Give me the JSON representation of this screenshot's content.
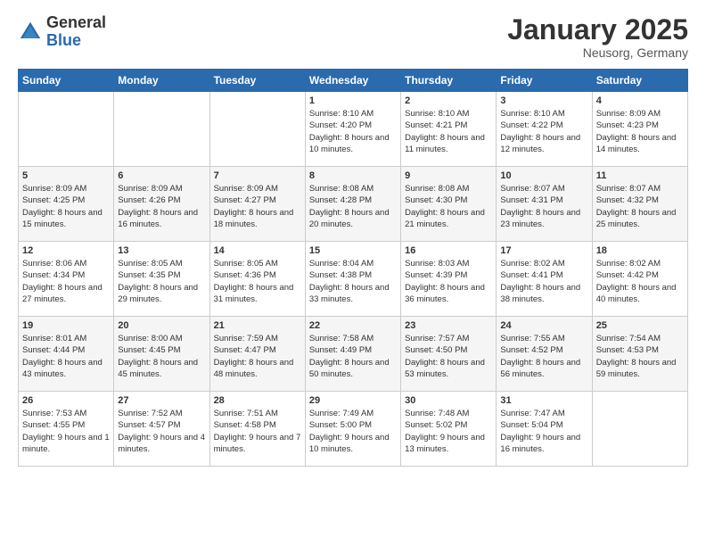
{
  "header": {
    "logo_general": "General",
    "logo_blue": "Blue",
    "month_title": "January 2025",
    "location": "Neusorg, Germany"
  },
  "days_of_week": [
    "Sunday",
    "Monday",
    "Tuesday",
    "Wednesday",
    "Thursday",
    "Friday",
    "Saturday"
  ],
  "weeks": [
    [
      {
        "day": "",
        "sunrise": "",
        "sunset": "",
        "daylight": ""
      },
      {
        "day": "",
        "sunrise": "",
        "sunset": "",
        "daylight": ""
      },
      {
        "day": "",
        "sunrise": "",
        "sunset": "",
        "daylight": ""
      },
      {
        "day": "1",
        "sunrise": "Sunrise: 8:10 AM",
        "sunset": "Sunset: 4:20 PM",
        "daylight": "Daylight: 8 hours and 10 minutes."
      },
      {
        "day": "2",
        "sunrise": "Sunrise: 8:10 AM",
        "sunset": "Sunset: 4:21 PM",
        "daylight": "Daylight: 8 hours and 11 minutes."
      },
      {
        "day": "3",
        "sunrise": "Sunrise: 8:10 AM",
        "sunset": "Sunset: 4:22 PM",
        "daylight": "Daylight: 8 hours and 12 minutes."
      },
      {
        "day": "4",
        "sunrise": "Sunrise: 8:09 AM",
        "sunset": "Sunset: 4:23 PM",
        "daylight": "Daylight: 8 hours and 14 minutes."
      }
    ],
    [
      {
        "day": "5",
        "sunrise": "Sunrise: 8:09 AM",
        "sunset": "Sunset: 4:25 PM",
        "daylight": "Daylight: 8 hours and 15 minutes."
      },
      {
        "day": "6",
        "sunrise": "Sunrise: 8:09 AM",
        "sunset": "Sunset: 4:26 PM",
        "daylight": "Daylight: 8 hours and 16 minutes."
      },
      {
        "day": "7",
        "sunrise": "Sunrise: 8:09 AM",
        "sunset": "Sunset: 4:27 PM",
        "daylight": "Daylight: 8 hours and 18 minutes."
      },
      {
        "day": "8",
        "sunrise": "Sunrise: 8:08 AM",
        "sunset": "Sunset: 4:28 PM",
        "daylight": "Daylight: 8 hours and 20 minutes."
      },
      {
        "day": "9",
        "sunrise": "Sunrise: 8:08 AM",
        "sunset": "Sunset: 4:30 PM",
        "daylight": "Daylight: 8 hours and 21 minutes."
      },
      {
        "day": "10",
        "sunrise": "Sunrise: 8:07 AM",
        "sunset": "Sunset: 4:31 PM",
        "daylight": "Daylight: 8 hours and 23 minutes."
      },
      {
        "day": "11",
        "sunrise": "Sunrise: 8:07 AM",
        "sunset": "Sunset: 4:32 PM",
        "daylight": "Daylight: 8 hours and 25 minutes."
      }
    ],
    [
      {
        "day": "12",
        "sunrise": "Sunrise: 8:06 AM",
        "sunset": "Sunset: 4:34 PM",
        "daylight": "Daylight: 8 hours and 27 minutes."
      },
      {
        "day": "13",
        "sunrise": "Sunrise: 8:05 AM",
        "sunset": "Sunset: 4:35 PM",
        "daylight": "Daylight: 8 hours and 29 minutes."
      },
      {
        "day": "14",
        "sunrise": "Sunrise: 8:05 AM",
        "sunset": "Sunset: 4:36 PM",
        "daylight": "Daylight: 8 hours and 31 minutes."
      },
      {
        "day": "15",
        "sunrise": "Sunrise: 8:04 AM",
        "sunset": "Sunset: 4:38 PM",
        "daylight": "Daylight: 8 hours and 33 minutes."
      },
      {
        "day": "16",
        "sunrise": "Sunrise: 8:03 AM",
        "sunset": "Sunset: 4:39 PM",
        "daylight": "Daylight: 8 hours and 36 minutes."
      },
      {
        "day": "17",
        "sunrise": "Sunrise: 8:02 AM",
        "sunset": "Sunset: 4:41 PM",
        "daylight": "Daylight: 8 hours and 38 minutes."
      },
      {
        "day": "18",
        "sunrise": "Sunrise: 8:02 AM",
        "sunset": "Sunset: 4:42 PM",
        "daylight": "Daylight: 8 hours and 40 minutes."
      }
    ],
    [
      {
        "day": "19",
        "sunrise": "Sunrise: 8:01 AM",
        "sunset": "Sunset: 4:44 PM",
        "daylight": "Daylight: 8 hours and 43 minutes."
      },
      {
        "day": "20",
        "sunrise": "Sunrise: 8:00 AM",
        "sunset": "Sunset: 4:45 PM",
        "daylight": "Daylight: 8 hours and 45 minutes."
      },
      {
        "day": "21",
        "sunrise": "Sunrise: 7:59 AM",
        "sunset": "Sunset: 4:47 PM",
        "daylight": "Daylight: 8 hours and 48 minutes."
      },
      {
        "day": "22",
        "sunrise": "Sunrise: 7:58 AM",
        "sunset": "Sunset: 4:49 PM",
        "daylight": "Daylight: 8 hours and 50 minutes."
      },
      {
        "day": "23",
        "sunrise": "Sunrise: 7:57 AM",
        "sunset": "Sunset: 4:50 PM",
        "daylight": "Daylight: 8 hours and 53 minutes."
      },
      {
        "day": "24",
        "sunrise": "Sunrise: 7:55 AM",
        "sunset": "Sunset: 4:52 PM",
        "daylight": "Daylight: 8 hours and 56 minutes."
      },
      {
        "day": "25",
        "sunrise": "Sunrise: 7:54 AM",
        "sunset": "Sunset: 4:53 PM",
        "daylight": "Daylight: 8 hours and 59 minutes."
      }
    ],
    [
      {
        "day": "26",
        "sunrise": "Sunrise: 7:53 AM",
        "sunset": "Sunset: 4:55 PM",
        "daylight": "Daylight: 9 hours and 1 minute."
      },
      {
        "day": "27",
        "sunrise": "Sunrise: 7:52 AM",
        "sunset": "Sunset: 4:57 PM",
        "daylight": "Daylight: 9 hours and 4 minutes."
      },
      {
        "day": "28",
        "sunrise": "Sunrise: 7:51 AM",
        "sunset": "Sunset: 4:58 PM",
        "daylight": "Daylight: 9 hours and 7 minutes."
      },
      {
        "day": "29",
        "sunrise": "Sunrise: 7:49 AM",
        "sunset": "Sunset: 5:00 PM",
        "daylight": "Daylight: 9 hours and 10 minutes."
      },
      {
        "day": "30",
        "sunrise": "Sunrise: 7:48 AM",
        "sunset": "Sunset: 5:02 PM",
        "daylight": "Daylight: 9 hours and 13 minutes."
      },
      {
        "day": "31",
        "sunrise": "Sunrise: 7:47 AM",
        "sunset": "Sunset: 5:04 PM",
        "daylight": "Daylight: 9 hours and 16 minutes."
      },
      {
        "day": "",
        "sunrise": "",
        "sunset": "",
        "daylight": ""
      }
    ]
  ]
}
